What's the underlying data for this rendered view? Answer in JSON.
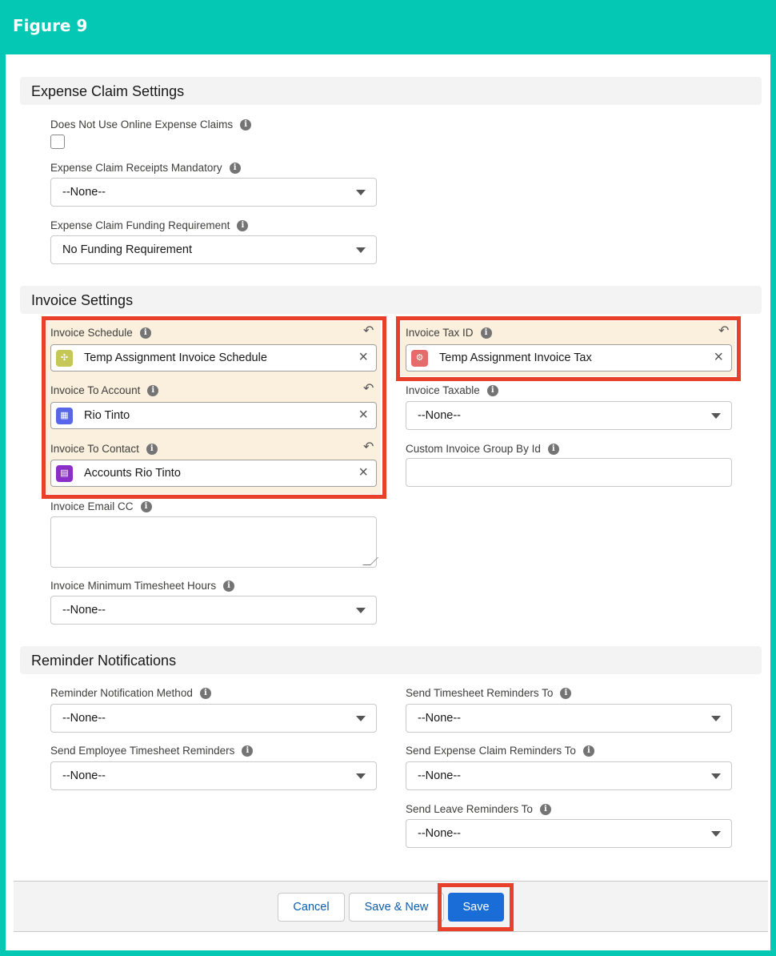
{
  "figure_title": "Figure 9",
  "sections": {
    "expense": "Expense Claim Settings",
    "invoice": "Invoice Settings",
    "reminder": "Reminder Notifications"
  },
  "expense": {
    "online_claims_label": "Does Not Use Online Expense Claims",
    "online_claims_checked": false,
    "receipts_label": "Expense Claim Receipts Mandatory",
    "receipts_value": "--None--",
    "funding_label": "Expense Claim Funding Requirement",
    "funding_value": "No Funding Requirement"
  },
  "invoice": {
    "schedule_label": "Invoice Schedule",
    "schedule_value": "Temp Assignment Invoice Schedule",
    "account_label": "Invoice To Account",
    "account_value": "Rio Tinto",
    "contact_label": "Invoice To Contact",
    "contact_value": "Accounts Rio Tinto",
    "email_cc_label": "Invoice Email CC",
    "email_cc_value": "",
    "min_hours_label": "Invoice Minimum Timesheet Hours",
    "min_hours_value": "--None--",
    "tax_id_label": "Invoice Tax ID",
    "tax_id_value": "Temp Assignment Invoice Tax",
    "taxable_label": "Invoice Taxable",
    "taxable_value": "--None--",
    "group_by_label": "Custom Invoice Group By Id",
    "group_by_value": ""
  },
  "reminder": {
    "method_label": "Reminder Notification Method",
    "method_value": "--None--",
    "employee_label": "Send Employee Timesheet Reminders",
    "employee_value": "--None--",
    "timesheet_to_label": "Send Timesheet Reminders To",
    "timesheet_to_value": "--None--",
    "expense_to_label": "Send Expense Claim Reminders To",
    "expense_to_value": "--None--",
    "leave_to_label": "Send Leave Reminders To",
    "leave_to_value": "--None--"
  },
  "footer": {
    "cancel": "Cancel",
    "save_new": "Save & New",
    "save": "Save"
  },
  "icons": {
    "info": "info-icon",
    "undo": "undo-icon",
    "clear": "close-icon",
    "caret": "chevron-down-icon"
  },
  "colors": {
    "frame": "#05c8b4",
    "highlight": "#e8402a",
    "changed_field": "#faf0dd",
    "brand_button": "#1a6dd7",
    "schedule_icon": "#c5c756",
    "account_icon": "#5867e8",
    "contact_icon": "#8a30c9",
    "tax_icon": "#e66a6a"
  }
}
